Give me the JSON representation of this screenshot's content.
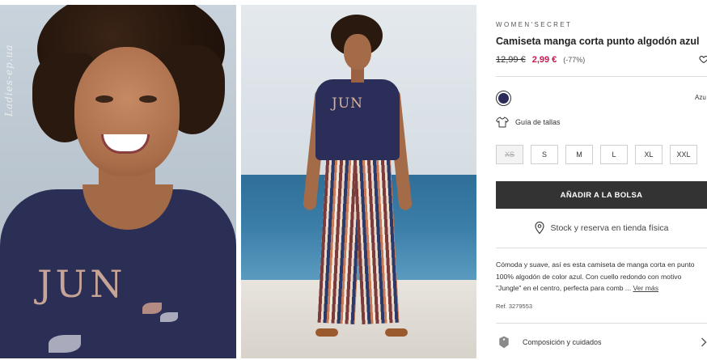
{
  "gallery": {
    "watermark": "Ladies-ep.ua",
    "shirt_print": "JUN",
    "shirt_print_small": "JUN"
  },
  "product": {
    "brand": "WOMEN'SECRET",
    "title": "Camiseta manga corta punto algodón azul",
    "old_price": "12,99 €",
    "new_price": "2,99 €",
    "discount": "(-77%)",
    "favorite_icon": "heart-icon",
    "color": {
      "swatch_hex": "#2b2c57",
      "name": "Azu"
    },
    "size_guide_label": "Guía de tallas",
    "sizes": [
      "XS",
      "S",
      "M",
      "L",
      "XL",
      "XXL"
    ],
    "add_to_bag_label": "AÑADIR A LA BOLSA",
    "stock_label": "Stock y reserva en tienda física",
    "description": "Cómoda y suave, así es esta camiseta de manga corta en punto 100% algodón de color azul. Con cuello redondo con motivo \"Jungle\" en el centro, perfecta para comb ...",
    "see_more_label": "Ver más",
    "reference": "Ref. 3279553",
    "composition_label": "Composición y cuidados"
  },
  "colors": {
    "accent_price": "#c8194f",
    "button_bg": "#333333",
    "divider": "#dcdcdc"
  }
}
